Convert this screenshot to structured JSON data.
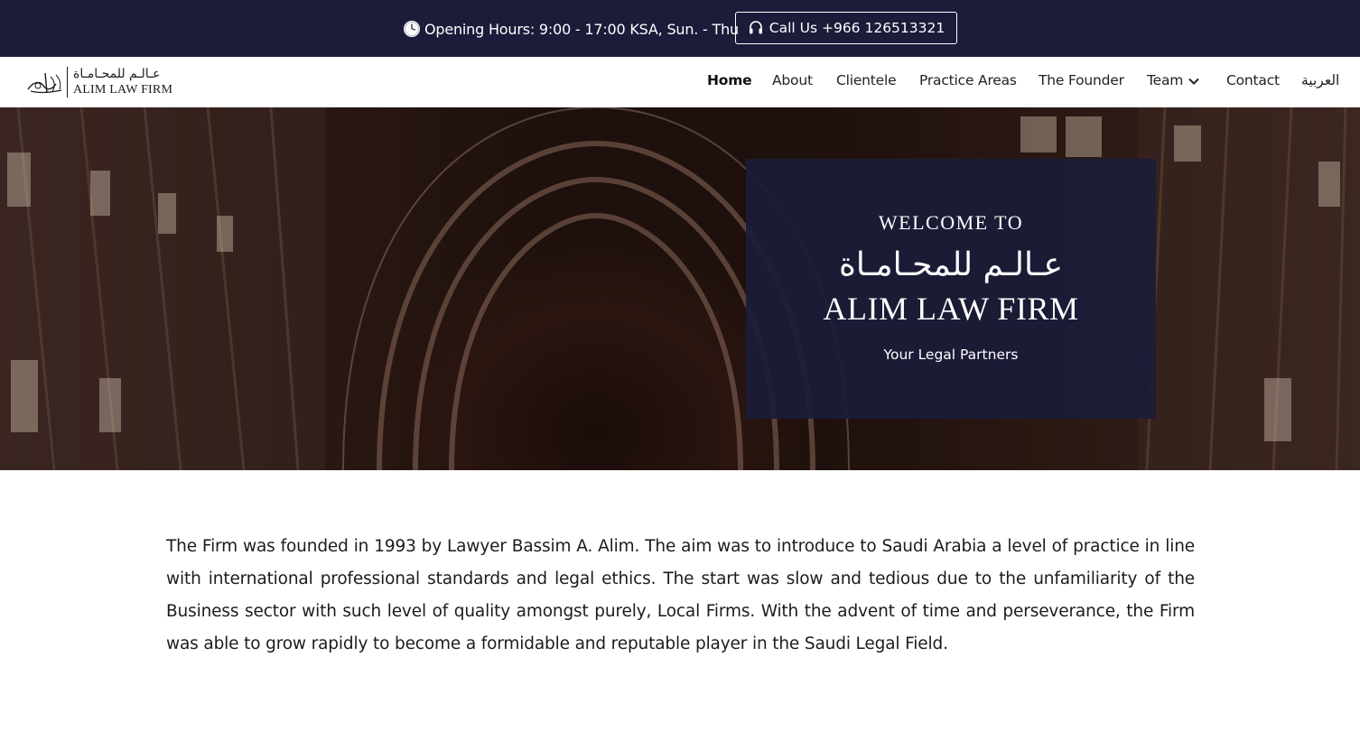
{
  "topbar": {
    "hours_text": "Opening Hours: 9:00 - 17:00 KSA, Sun. - Thu",
    "clock_icon": "clock-icon",
    "call_label": "Call Us +966 126513321",
    "call_icon": "headset-icon"
  },
  "nav": {
    "logo": {
      "arabic": "عـالـم للمحـامـاة",
      "english": "ALIM LAW FIRM"
    },
    "items": [
      {
        "label": "Home",
        "active": true
      },
      {
        "label": "About"
      },
      {
        "label": "Clientele"
      },
      {
        "label": "Practice Areas"
      },
      {
        "label": "The Founder"
      },
      {
        "label": "Team",
        "has_dropdown": true
      },
      {
        "label": "Contact"
      },
      {
        "label": "العربية"
      }
    ]
  },
  "hero": {
    "welcome": "WELCOME TO",
    "arabic_name": "عـالـم للمحـامـاة",
    "firm_name": "ALIM LAW FIRM",
    "tagline": "Your Legal Partners"
  },
  "intro": {
    "text": "The Firm was founded in 1993 by Lawyer Bassim A. Alim. The aim was to introduce to Saudi Arabia a level of practice in line with international professional standards and legal ethics. The start was slow and tedious due to the unfamiliarity of the Business sector with such level of quality amongst purely, Local Firms. With the advent of time and perseverance, the Firm was able to grow rapidly to become a formidable and reputable player in the Saudi Legal Field."
  },
  "colors": {
    "navy": "#1b1c3a",
    "white": "#ffffff",
    "text": "#1c1c1c"
  }
}
